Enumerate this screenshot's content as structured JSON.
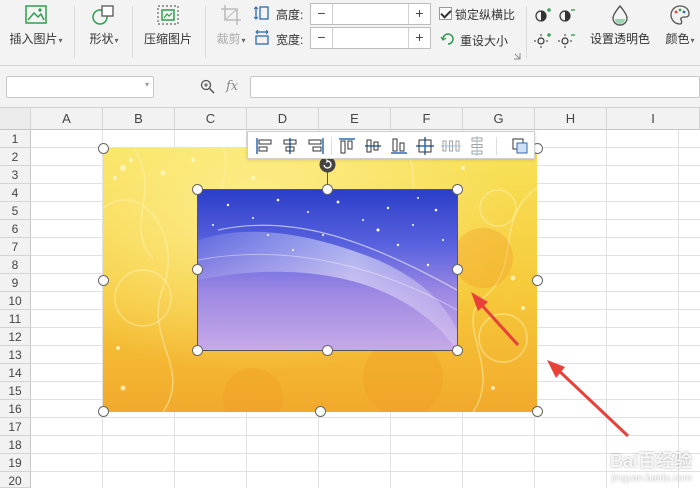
{
  "ribbon": {
    "insert_picture": "插入图片",
    "shape": "形状",
    "compress_picture": "压缩图片",
    "crop": "裁剪",
    "height_label": "高度:",
    "width_label": "宽度:",
    "lock_ratio": "锁定纵横比",
    "reset_size": "重设大小",
    "set_transparent": "设置透明色",
    "color": "颜色"
  },
  "formula_bar": {
    "fx": "fx"
  },
  "columns": [
    "A",
    "B",
    "C",
    "D",
    "E",
    "F",
    "G",
    "H",
    "I"
  ],
  "rows": [
    "1",
    "2",
    "3",
    "4",
    "5",
    "6",
    "7",
    "8",
    "9",
    "10",
    "11",
    "12",
    "13",
    "14",
    "15",
    "16",
    "17",
    "18",
    "19",
    "20"
  ],
  "watermark": {
    "brand": "Bai百经验",
    "site": "jingyan.baidu.com"
  },
  "colors": {
    "arrow": "#e8413a",
    "accent_green": "#2e9f4e"
  }
}
